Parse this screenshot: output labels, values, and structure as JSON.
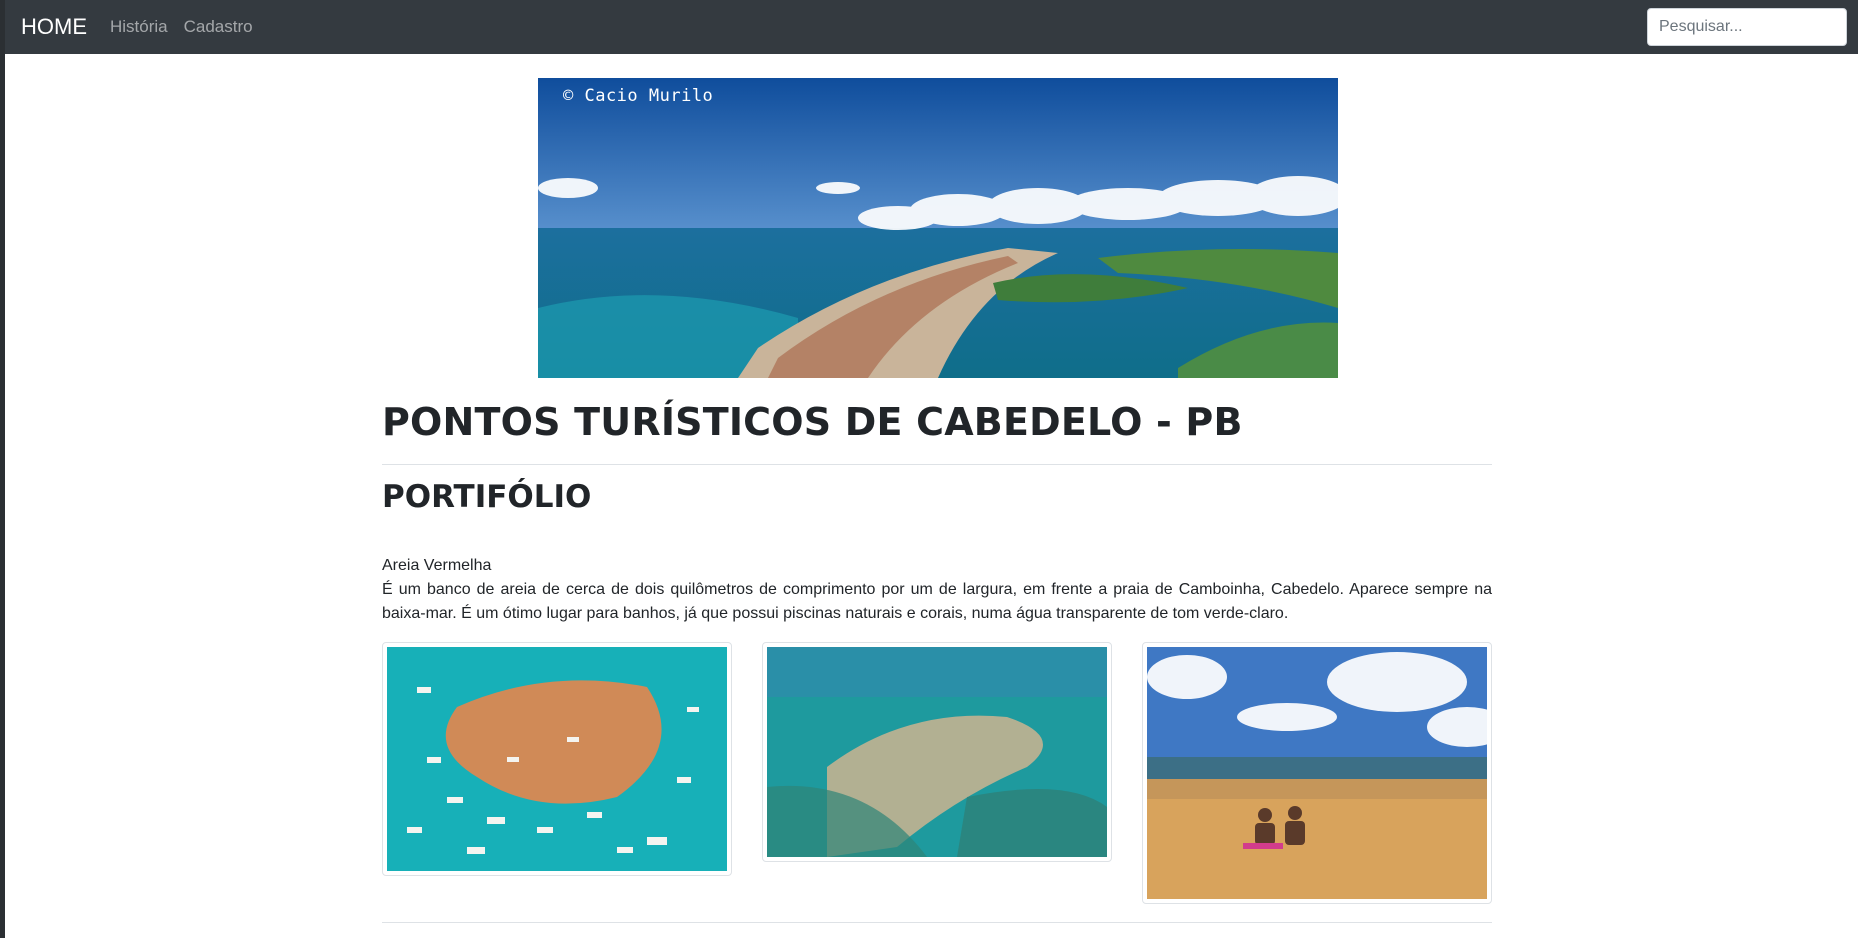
{
  "navbar": {
    "brand": "HOME",
    "links": [
      "História",
      "Cadastro"
    ],
    "search_placeholder": "Pesquisar..."
  },
  "hero": {
    "credit": "© Cacio Murilo"
  },
  "page": {
    "title": "PONTOS TURÍSTICOS DE CABEDELO - PB",
    "section": "PORTIFÓLIO",
    "item_name": "Areia Vermelha",
    "item_description": "É um banco de areia de cerca de dois quilômetros de comprimento por um de largura, em frente a praia de Camboinha, Cabedelo. Aparece sempre na baixa-mar. É um ótimo lugar para banhos, já que possui piscinas naturais e corais, numa água transparente de tom verde-claro."
  },
  "colors": {
    "navbar_bg": "#343a40",
    "sea": "#1aa6b0",
    "sand": "#d9a86a",
    "sky": "#2f6fb8"
  }
}
